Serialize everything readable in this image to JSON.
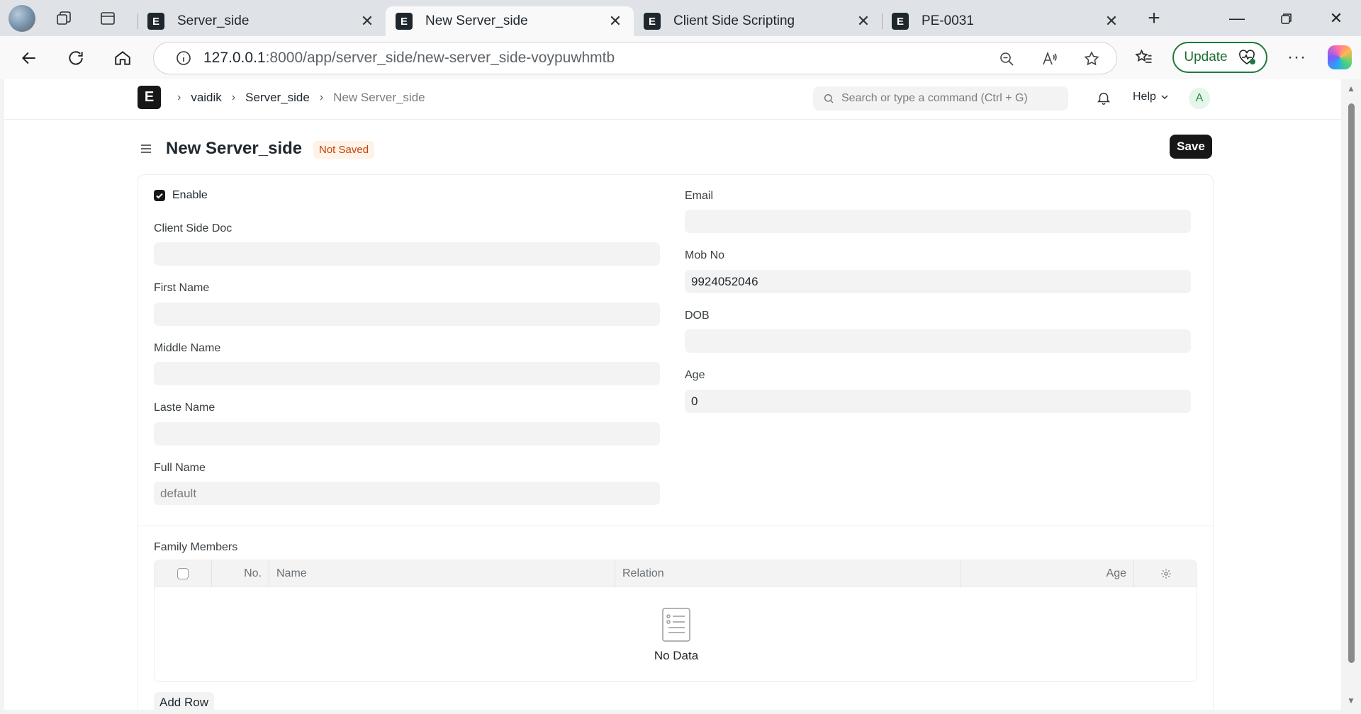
{
  "browser": {
    "tabs": [
      {
        "label": "Server_side",
        "favicon": "E"
      },
      {
        "label": "New Server_side",
        "favicon": "E"
      },
      {
        "label": "Client Side Scripting",
        "favicon": "E"
      },
      {
        "label": "PE-0031",
        "favicon": "E"
      }
    ],
    "url_host": "127.0.0.1",
    "url_rest": ":8000/app/server_side/new-server_side-voypuwhmtb",
    "update_label": "Update"
  },
  "navbar": {
    "logo": "E",
    "breadcrumbs": [
      "vaidik",
      "Server_side",
      "New Server_side"
    ],
    "search_placeholder": "Search or type a command (Ctrl + G)",
    "help_label": "Help",
    "avatar_initial": "A"
  },
  "page": {
    "title": "New Server_side",
    "status": "Not Saved",
    "save_label": "Save"
  },
  "form": {
    "enable_label": "Enable",
    "enable_checked": true,
    "left_fields": [
      {
        "label": "Client Side Doc",
        "value": ""
      },
      {
        "label": "First Name",
        "value": ""
      },
      {
        "label": "Middle Name",
        "value": ""
      },
      {
        "label": "Laste Name",
        "value": ""
      },
      {
        "label": "Full Name",
        "value": "default"
      }
    ],
    "right_fields": [
      {
        "label": "Email",
        "value": ""
      },
      {
        "label": "Mob No",
        "value": "9924052046"
      },
      {
        "label": "DOB",
        "value": ""
      },
      {
        "label": "Age",
        "value": "0"
      }
    ]
  },
  "family": {
    "section_label": "Family Members",
    "columns": [
      "No.",
      "Name",
      "Relation",
      "Age"
    ],
    "empty_text": "No Data",
    "add_row_label": "Add Row"
  },
  "colors": {
    "primary": "#171717",
    "badge_bg": "#fff2e6",
    "badge_text": "#c2410c",
    "update_green": "#1c7a3c"
  }
}
